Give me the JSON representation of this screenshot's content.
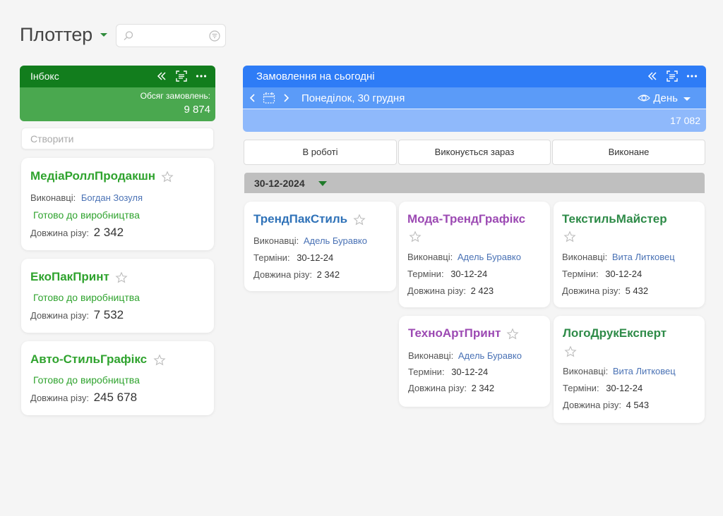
{
  "app": {
    "title": "Плоттер"
  },
  "search": {
    "placeholder": ""
  },
  "inbox": {
    "title": "Інбокс",
    "volume_label": "Обсяг замовлень:",
    "volume_value": "9 874",
    "create_label": "Створити",
    "cards": [
      {
        "name": "МедіаРоллПродакшн",
        "executors_label": "Виконавці:",
        "executor": "Богдан Зозуля",
        "status": "Готово до виробництва",
        "length_label": "Довжина різу:",
        "length": "2 342"
      },
      {
        "name": "ЕкоПакПринт",
        "status": "Готово до виробництва",
        "length_label": "Довжина різу:",
        "length": "7 532"
      },
      {
        "name": "Авто-СтильГрафікс",
        "status": "Готово до виробництва",
        "length_label": "Довжина різу:",
        "length": "245 678"
      }
    ]
  },
  "orders": {
    "title": "Замовлення на сьогодні",
    "date": "Понеділок, 30 грудня",
    "view": "День",
    "total": "17 082",
    "tabs": [
      "В роботі",
      "Виконується зараз",
      "Виконане"
    ],
    "group_date": "30-12-2024",
    "cards": [
      {
        "name": "ТрендПакСтиль",
        "executors_label": "Виконавці:",
        "executor": "Адель Буравко",
        "terms_label": "Терміни:",
        "terms": "30-12-24",
        "length_label": "Довжина різу:",
        "length": "2 342"
      },
      {
        "name": "Мода-ТрендГрафікс",
        "executors_label": "Виконавці:",
        "executor": "Адель Буравко",
        "terms_label": "Терміни:",
        "terms": "30-12-24",
        "length_label": "Довжина різу:",
        "length": "2 423"
      },
      {
        "name": "ТекстильМайстер",
        "executors_label": "Виконавці:",
        "executor": "Вита Литковец",
        "terms_label": "Терміни:",
        "terms": "30-12-24",
        "length_label": "Довжина різу:",
        "length": "5 432"
      },
      {
        "name": "ТехноАртПринт",
        "executors_label": "Виконавці:",
        "executor": "Адель Буравко",
        "terms_label": "Терміни:",
        "terms": "30-12-24",
        "length_label": "Довжина різу:",
        "length": "2 342"
      },
      {
        "name": "ЛогоДрукЕксперт",
        "executors_label": "Виконавці:",
        "executor": "Вита Литковец",
        "terms_label": "Терміни:",
        "terms": "30-12-24",
        "length_label": "Довжина різу:",
        "length": "4 543"
      }
    ]
  },
  "colors": {
    "inbox_dark": "#127d1d",
    "inbox_light": "#4aa84f",
    "orders_dark": "#2e7cf6",
    "orders_mid": "#5b9bf8",
    "orders_light": "#8fb9fb"
  }
}
